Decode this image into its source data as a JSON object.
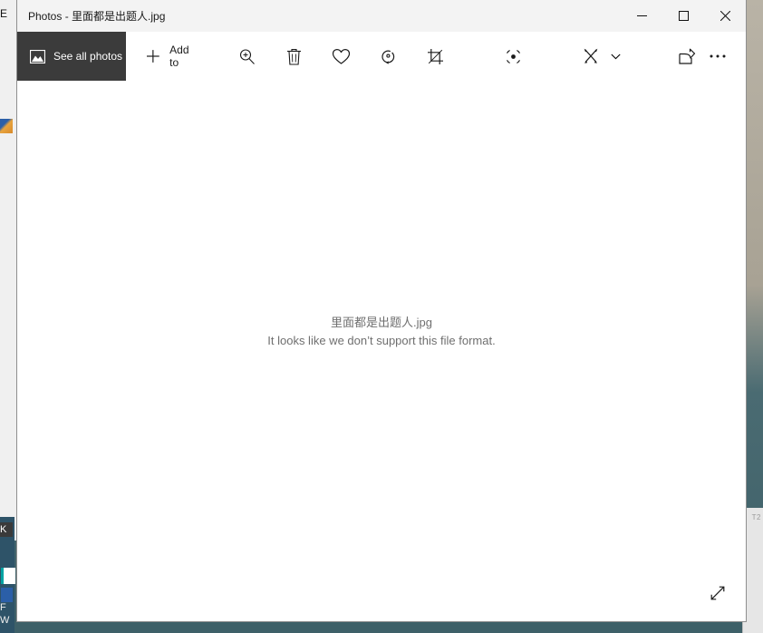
{
  "window": {
    "app_name": "Photos",
    "title": "Photos - 里面都是出题人.jpg",
    "controls": {
      "minimize": "minimize-icon",
      "maximize": "maximize-icon",
      "close": "close-icon"
    }
  },
  "toolbar": {
    "see_all_photos_label": "See all photos",
    "see_all_photos_icon": "picture-icon",
    "add_to_label": "Add to",
    "add_to_icon": "plus-icon",
    "items": [
      {
        "name": "zoom-button",
        "icon": "zoom-in-icon"
      },
      {
        "name": "delete-button",
        "icon": "trash-icon"
      },
      {
        "name": "favorite-button",
        "icon": "heart-icon"
      },
      {
        "name": "rotate-button",
        "icon": "rotate-icon"
      },
      {
        "name": "crop-button",
        "icon": "crop-icon"
      },
      {
        "name": "enhance-button",
        "icon": "enhance-icon"
      },
      {
        "name": "draw-button",
        "icon": "draw-icon"
      },
      {
        "name": "draw-dropdown",
        "icon": "chevron-down-icon"
      },
      {
        "name": "share-button",
        "icon": "share-icon"
      },
      {
        "name": "more-button",
        "icon": "ellipsis-icon"
      }
    ]
  },
  "canvas": {
    "file_name": "里面都是出题人.jpg",
    "error_message": "It looks like we don’t support this file format.",
    "fullscreen_icon": "expand-arrows-icon"
  },
  "background": {
    "left_window_letter": "E",
    "taskbar_letter_k": "K",
    "taskbar_letter_f": "F",
    "taskbar_letter_w": "W",
    "right_sliver_text": "T2"
  },
  "colors": {
    "accent_dark": "#3b3b3b",
    "titlebar": "#f3f3f3",
    "canvas": "#ffffff",
    "text_muted": "#6f6f6f",
    "desktop": "#3e6068"
  }
}
